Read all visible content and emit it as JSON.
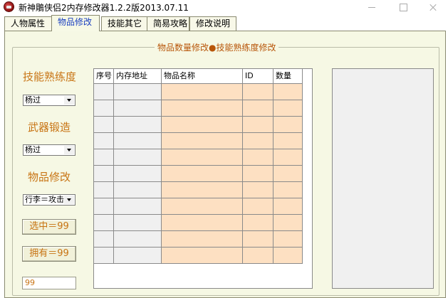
{
  "window": {
    "title": "新神鵰侠侣2内存修改器1.2.2版2013.07.11"
  },
  "tabs": [
    {
      "label": "人物属性"
    },
    {
      "label": "物品修改"
    },
    {
      "label": "技能其它"
    },
    {
      "label": "简易攻略"
    },
    {
      "label": "修改说明"
    }
  ],
  "group": {
    "legend": "物品数量修改●技能熟练度修改"
  },
  "left": {
    "skill_label": "技能熟练度",
    "skill_combo": "杨过",
    "forge_label": "武器锻造",
    "forge_combo": "杨过",
    "item_label": "物品修改",
    "item_combo": "行李＝攻击",
    "select_button": "选中＝99",
    "own_button": "拥有＝99",
    "value_field": "99"
  },
  "table": {
    "columns": [
      "序号",
      "内存地址",
      "物品名称",
      "ID",
      "数量"
    ],
    "row_count": 11
  },
  "watermark": "..."
}
